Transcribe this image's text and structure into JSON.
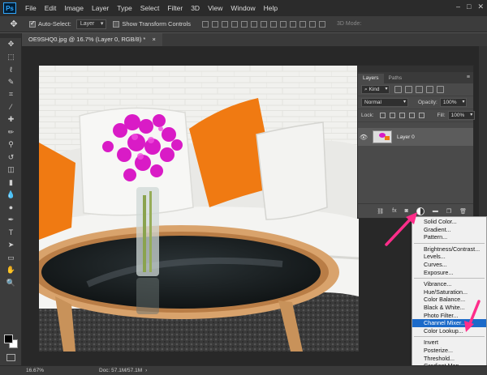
{
  "app": {
    "logo": "Ps"
  },
  "menu": [
    "File",
    "Edit",
    "Image",
    "Layer",
    "Type",
    "Select",
    "Filter",
    "3D",
    "View",
    "Window",
    "Help"
  ],
  "window_controls": [
    "–",
    "□",
    "✕"
  ],
  "options": {
    "auto_select_label": "Auto-Select:",
    "auto_select_value": "Layer",
    "show_transform_label": "Show Transform Controls",
    "mode_3d_label": "3D Mode:"
  },
  "document": {
    "tab_title": "OE9SHQ0.jpg @ 16.7% (Layer 0, RGB/8) *",
    "tab_close": "×"
  },
  "tools": [
    "move-icon",
    "marquee-icon",
    "lasso-icon",
    "quick-select-icon",
    "crop-icon",
    "eyedropper-icon",
    "healing-icon",
    "brush-icon",
    "stamp-icon",
    "history-brush-icon",
    "eraser-icon",
    "gradient-icon",
    "blur-icon",
    "dodge-icon",
    "pen-icon",
    "type-icon",
    "path-select-icon",
    "shape-icon",
    "hand-icon",
    "zoom-icon"
  ],
  "tool_glyphs": [
    "✥",
    "⬚",
    "ℓ",
    "✎",
    "⌗",
    "⁄",
    "✚",
    "✏",
    "⚲",
    "↺",
    "◫",
    "▮",
    "💧",
    "●",
    "✒",
    "T",
    "➤",
    "▭",
    "✋",
    "🔍"
  ],
  "layers_panel": {
    "tabs": [
      "Layers",
      "Paths"
    ],
    "filter_kind": "Kind",
    "blend_mode": "Normal",
    "opacity_label": "Opacity:",
    "opacity_value": "100%",
    "lock_label": "Lock:",
    "fill_label": "Fill:",
    "fill_value": "100%",
    "layer_name": "Layer 0",
    "bottom_icons": [
      "fx"
    ]
  },
  "adjustment_menu": {
    "groups": [
      [
        "Solid Color...",
        "Gradient...",
        "Pattern..."
      ],
      [
        "Brightness/Contrast...",
        "Levels...",
        "Curves...",
        "Exposure..."
      ],
      [
        "Vibrance...",
        "Hue/Saturation...",
        "Color Balance...",
        "Black & White...",
        "Photo Filter...",
        "Channel Mixer...",
        "Color Lookup..."
      ],
      [
        "Invert",
        "Posterize...",
        "Threshold...",
        "Gradient Map..."
      ]
    ],
    "highlighted": "Channel Mixer..."
  },
  "status": {
    "zoom": "16.67%",
    "doc_info": "Doc: 57.1M/57.1M"
  },
  "colors": {
    "accent": "#1b6ac9",
    "arrow": "#ff2d8a",
    "orchid": "#d91bc6",
    "pillow": "#f07a12"
  }
}
